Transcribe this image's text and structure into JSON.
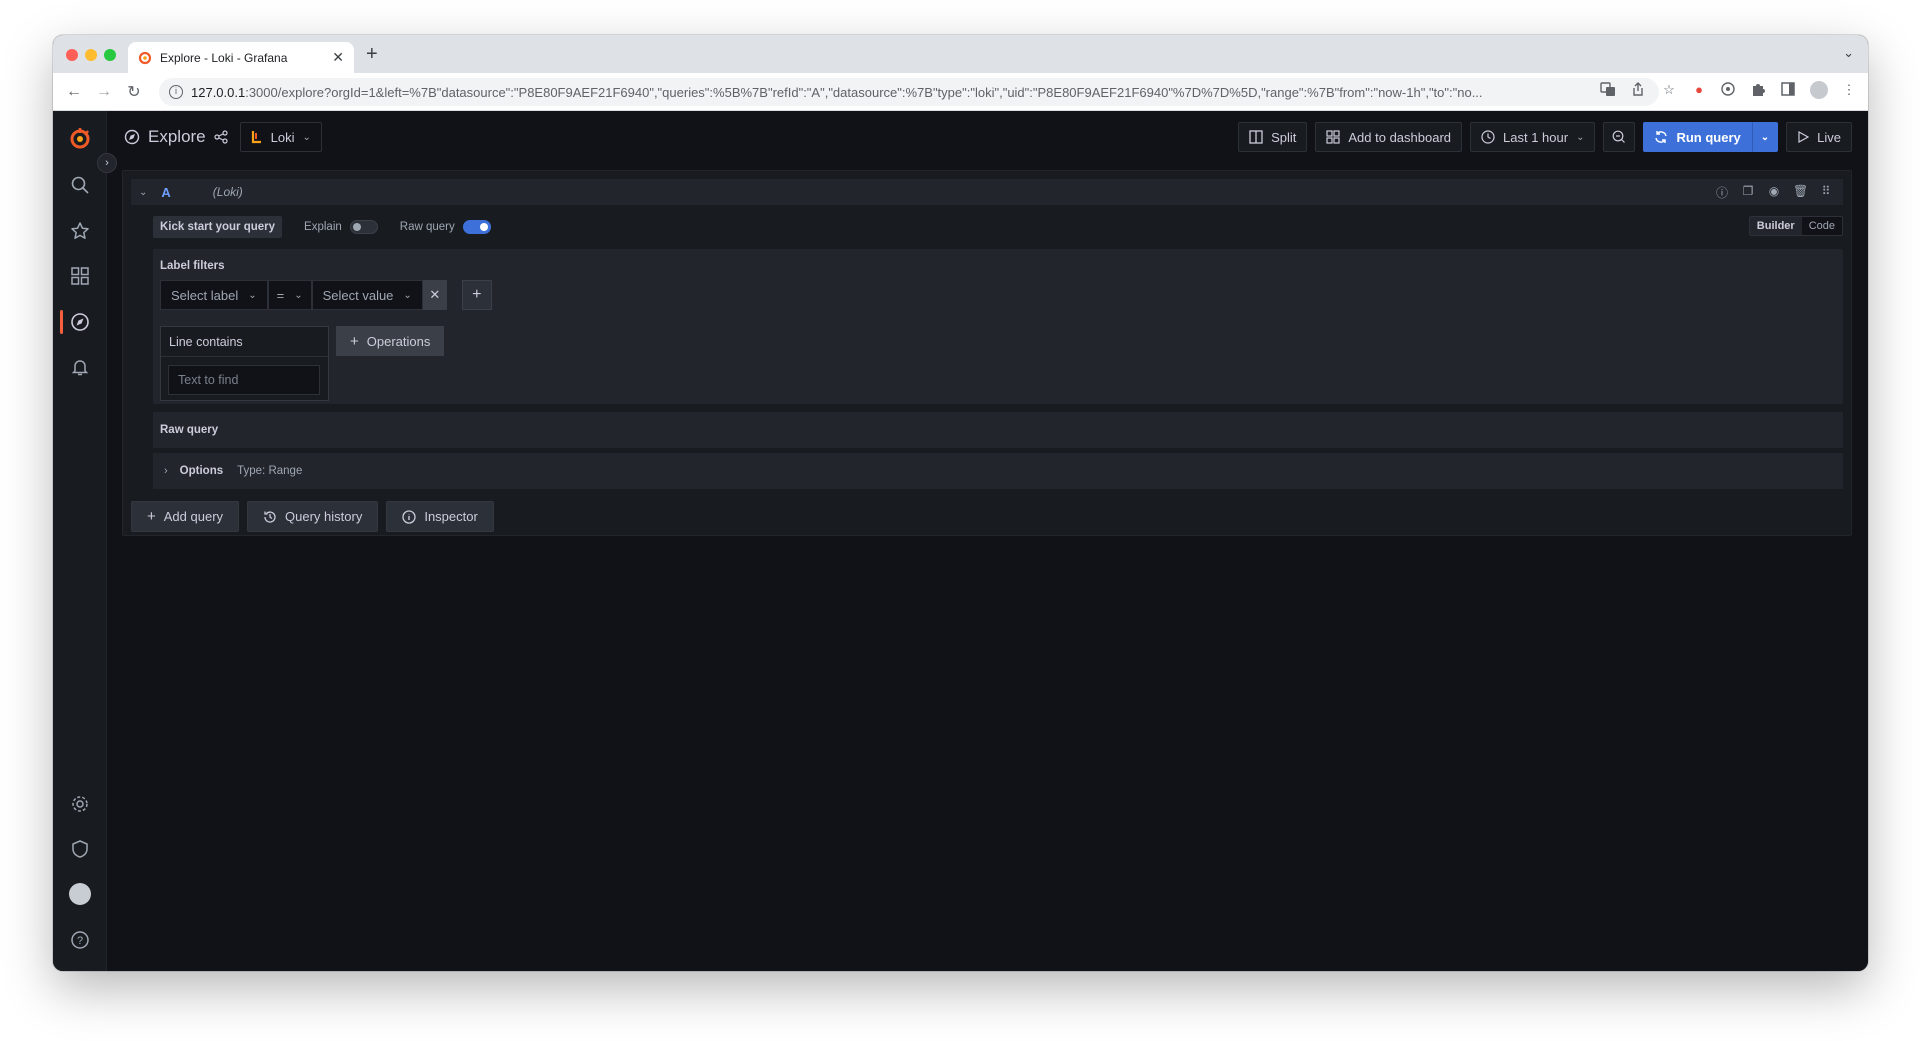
{
  "browser": {
    "tab_title": "Explore - Loki - Grafana",
    "url_host": "127.0.0.1",
    "url_path": ":3000/explore?orgId=1&left=%7B\"datasource\":\"P8E80F9AEF21F6940\",\"queries\":%5B%7B\"refId\":\"A\",\"datasource\":%7B\"type\":\"loki\",\"uid\":\"P8E80F9AEF21F6940\"%7D%7D%5D,\"range\":%7B\"from\":\"now-1h\",\"to\":\"no...",
    "icons": [
      "back-icon",
      "forward-icon",
      "reload-icon",
      "translate-icon",
      "share-icon",
      "star-icon",
      "record-icon",
      "extension-icon",
      "puzzle-icon",
      "sidepanel-icon",
      "profile-icon",
      "menu-icon"
    ]
  },
  "grafana": {
    "page_title": "Explore",
    "datasource": "Loki",
    "toolbar": {
      "split": "Split",
      "add_to_dashboard": "Add to dashboard",
      "time_range": "Last 1 hour",
      "run_query": "Run query",
      "live": "Live"
    },
    "query_row": {
      "ref_id": "A",
      "datasource_label": "(Loki)",
      "kick_start": "Kick start your query",
      "explain_label": "Explain",
      "explain_on": false,
      "raw_query_label": "Raw query",
      "raw_query_on": true,
      "mode_builder": "Builder",
      "mode_code": "Code",
      "active_mode": "Builder"
    },
    "label_filters": {
      "title": "Label filters",
      "label_placeholder": "Select label",
      "operator": "=",
      "value_placeholder": "Select value"
    },
    "operation": {
      "title": "Line contains",
      "input_placeholder": "Text to find",
      "operations_button": "Operations"
    },
    "raw_query_section": "Raw query",
    "options": {
      "label": "Options",
      "type": "Type: Range"
    },
    "bottom_actions": {
      "add_query": "Add query",
      "query_history": "Query history",
      "inspector": "Inspector"
    }
  },
  "colors": {
    "background": "#111217",
    "panel": "#181b1f",
    "primary": "#3d71d9",
    "accent": "#f55f3e"
  }
}
